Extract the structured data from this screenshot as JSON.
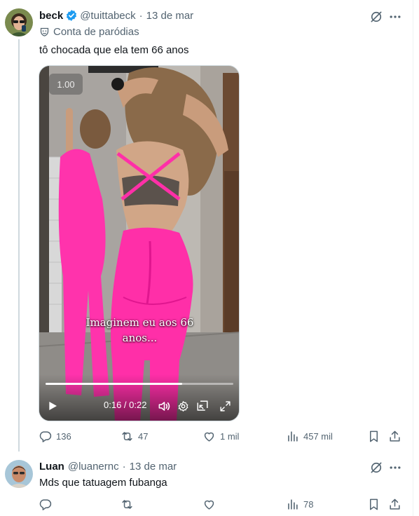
{
  "tweet": {
    "author_name": "beck",
    "handle": "@tuittabeck",
    "date": "13 de mar",
    "separator": "·",
    "parody_label": "Conta de paródias",
    "text": "tô chocada que ela tem 66 anos",
    "video": {
      "speed": "1.00",
      "caption_line1": "Imaginem eu aos 66",
      "caption_line2": "anos...",
      "time": "0:16 / 0:22",
      "progress": 0.727
    },
    "replies": "136",
    "retweets": "47",
    "likes": "1 mil",
    "views": "457 mil"
  },
  "reply": {
    "author_name": "Luan",
    "handle": "@luanernc",
    "date": "13 de mar",
    "separator": "·",
    "text": "Mds que tatuagem fubanga",
    "views": "78"
  },
  "colors": {
    "text": "#0f1419",
    "muted": "#536471",
    "verified": "#1d9bf0",
    "outfit_pink": "#ff2fa8"
  }
}
